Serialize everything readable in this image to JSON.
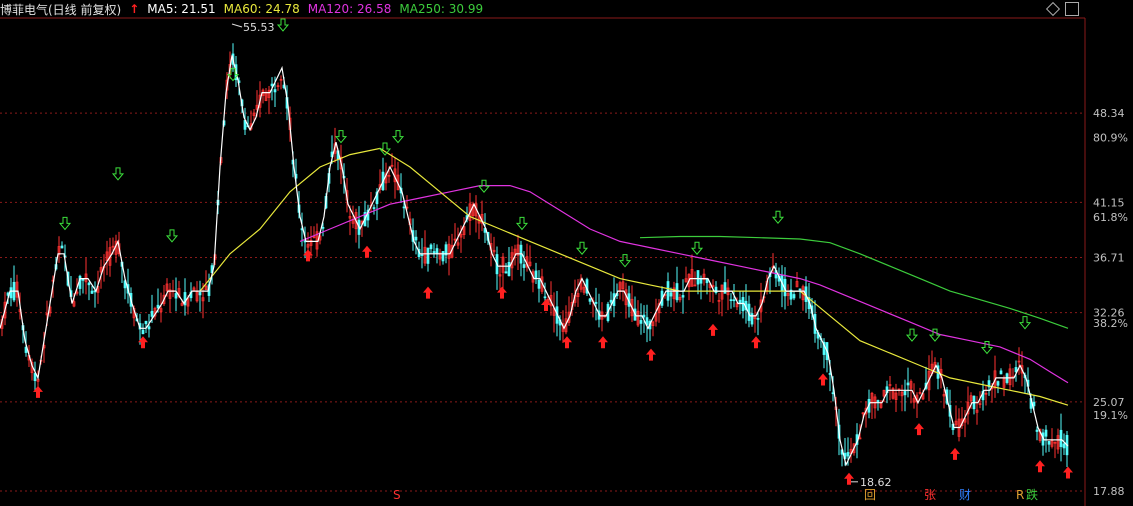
{
  "header": {
    "stock_title": "博菲电气(日线 前复权)",
    "ma5": "MA5: 21.51",
    "ma60": "MA60: 24.78",
    "ma120": "MA120: 26.58",
    "ma250": "MA250: 30.99"
  },
  "colors": {
    "background": "#000000",
    "up": "#ff3232",
    "down": "#54fcfc",
    "ma5": "#ffffff",
    "ma60": "#e8e83c",
    "ma120": "#e033e0",
    "ma250": "#3ccc3c",
    "grid": "#8a1a1a",
    "axis_text": "#c0c0c0",
    "buy_arrow": "#ff2020",
    "sell_arrow": "#3ce03c"
  },
  "price_axis": {
    "prices": [
      "48.34",
      "41.15",
      "36.71",
      "32.26",
      "25.07",
      "17.88"
    ],
    "percents": [
      "80.9%",
      "61.8%",
      "38.2%",
      "19.1%"
    ]
  },
  "annotations": {
    "high_label": "55.53",
    "low_label": "18.62"
  },
  "event_badges": [
    "S",
    "回",
    "张",
    "财",
    "R",
    "跌"
  ],
  "chart_data": {
    "type": "candlestick",
    "title": "博菲电气(日线 前复权)",
    "y_range": [
      17.88,
      55.53
    ],
    "high": 55.53,
    "low": 18.62,
    "ma_current": {
      "MA5": 21.51,
      "MA60": 24.78,
      "MA120": 26.58,
      "MA250": 30.99
    },
    "ma5_path": [
      [
        0,
        31
      ],
      [
        10,
        34
      ],
      [
        18,
        34
      ],
      [
        25,
        30
      ],
      [
        32,
        28
      ],
      [
        38,
        27
      ],
      [
        44,
        30
      ],
      [
        50,
        33
      ],
      [
        58,
        37
      ],
      [
        64,
        37
      ],
      [
        72,
        33
      ],
      [
        80,
        35
      ],
      [
        88,
        35
      ],
      [
        96,
        34
      ],
      [
        104,
        36
      ],
      [
        112,
        37
      ],
      [
        118,
        38
      ],
      [
        125,
        35
      ],
      [
        132,
        33
      ],
      [
        140,
        31
      ],
      [
        146,
        31
      ],
      [
        154,
        32
      ],
      [
        162,
        33
      ],
      [
        168,
        34
      ],
      [
        176,
        34
      ],
      [
        184,
        33
      ],
      [
        192,
        34
      ],
      [
        200,
        34
      ],
      [
        208,
        34
      ],
      [
        214,
        36
      ],
      [
        220,
        44
      ],
      [
        226,
        50
      ],
      [
        232,
        53
      ],
      [
        238,
        51
      ],
      [
        244,
        48
      ],
      [
        250,
        47
      ],
      [
        256,
        48
      ],
      [
        262,
        50
      ],
      [
        270,
        50
      ],
      [
        276,
        51
      ],
      [
        282,
        52
      ],
      [
        288,
        49
      ],
      [
        294,
        44
      ],
      [
        300,
        40
      ],
      [
        306,
        38
      ],
      [
        312,
        38
      ],
      [
        318,
        38
      ],
      [
        324,
        40
      ],
      [
        330,
        44
      ],
      [
        336,
        46
      ],
      [
        342,
        44
      ],
      [
        348,
        41
      ],
      [
        354,
        40
      ],
      [
        360,
        39
      ],
      [
        366,
        40
      ],
      [
        372,
        41
      ],
      [
        378,
        42
      ],
      [
        384,
        43
      ],
      [
        390,
        44
      ],
      [
        396,
        43
      ],
      [
        402,
        42
      ],
      [
        408,
        40
      ],
      [
        414,
        38
      ],
      [
        420,
        37
      ],
      [
        426,
        37
      ],
      [
        432,
        37
      ],
      [
        438,
        37
      ],
      [
        444,
        37
      ],
      [
        450,
        37
      ],
      [
        456,
        38
      ],
      [
        462,
        39
      ],
      [
        468,
        40
      ],
      [
        474,
        41
      ],
      [
        480,
        40
      ],
      [
        486,
        39
      ],
      [
        492,
        37
      ],
      [
        498,
        36
      ],
      [
        504,
        36
      ],
      [
        510,
        36
      ],
      [
        516,
        37
      ],
      [
        522,
        37
      ],
      [
        528,
        36
      ],
      [
        534,
        35
      ],
      [
        540,
        35
      ],
      [
        546,
        34
      ],
      [
        552,
        33
      ],
      [
        558,
        32
      ],
      [
        564,
        31
      ],
      [
        570,
        32
      ],
      [
        576,
        34
      ],
      [
        582,
        35
      ],
      [
        588,
        34
      ],
      [
        594,
        33
      ],
      [
        600,
        32
      ],
      [
        606,
        32
      ],
      [
        612,
        33
      ],
      [
        618,
        34
      ],
      [
        624,
        34
      ],
      [
        630,
        33
      ],
      [
        636,
        32
      ],
      [
        642,
        32
      ],
      [
        648,
        31
      ],
      [
        654,
        32
      ],
      [
        660,
        33
      ],
      [
        666,
        34
      ],
      [
        672,
        34
      ],
      [
        678,
        34
      ],
      [
        684,
        34
      ],
      [
        690,
        35
      ],
      [
        696,
        35
      ],
      [
        702,
        35
      ],
      [
        708,
        35
      ],
      [
        714,
        34
      ],
      [
        720,
        34
      ],
      [
        726,
        34
      ],
      [
        732,
        34
      ],
      [
        738,
        33
      ],
      [
        744,
        33
      ],
      [
        750,
        32
      ],
      [
        756,
        32
      ],
      [
        762,
        33
      ],
      [
        768,
        35
      ],
      [
        774,
        36
      ],
      [
        780,
        35
      ],
      [
        786,
        34
      ],
      [
        792,
        34
      ],
      [
        798,
        34
      ],
      [
        804,
        34
      ],
      [
        810,
        33
      ],
      [
        816,
        31
      ],
      [
        822,
        30
      ],
      [
        828,
        29
      ],
      [
        834,
        26
      ],
      [
        840,
        22
      ],
      [
        846,
        20
      ],
      [
        852,
        21
      ],
      [
        858,
        22
      ],
      [
        864,
        24
      ],
      [
        870,
        25
      ],
      [
        876,
        25
      ],
      [
        882,
        25
      ],
      [
        888,
        26
      ],
      [
        894,
        26
      ],
      [
        900,
        26
      ],
      [
        906,
        26
      ],
      [
        912,
        26
      ],
      [
        918,
        25
      ],
      [
        924,
        26
      ],
      [
        930,
        27
      ],
      [
        936,
        28
      ],
      [
        942,
        27
      ],
      [
        948,
        25
      ],
      [
        954,
        23
      ],
      [
        960,
        23
      ],
      [
        966,
        24
      ],
      [
        972,
        25
      ],
      [
        978,
        25
      ],
      [
        984,
        26
      ],
      [
        990,
        26
      ],
      [
        996,
        27
      ],
      [
        1002,
        27
      ],
      [
        1008,
        27
      ],
      [
        1014,
        27
      ],
      [
        1020,
        28
      ],
      [
        1026,
        27
      ],
      [
        1032,
        25
      ],
      [
        1038,
        23
      ],
      [
        1044,
        22
      ],
      [
        1050,
        22
      ],
      [
        1056,
        22
      ],
      [
        1062,
        22
      ],
      [
        1068,
        21.5
      ]
    ],
    "ma60_path": [
      [
        200,
        34
      ],
      [
        230,
        37
      ],
      [
        260,
        39
      ],
      [
        290,
        42
      ],
      [
        320,
        44
      ],
      [
        350,
        45
      ],
      [
        380,
        45.5
      ],
      [
        410,
        44
      ],
      [
        440,
        42
      ],
      [
        470,
        40
      ],
      [
        500,
        39
      ],
      [
        530,
        38
      ],
      [
        560,
        37
      ],
      [
        590,
        36
      ],
      [
        620,
        35
      ],
      [
        650,
        34.5
      ],
      [
        680,
        34
      ],
      [
        710,
        34
      ],
      [
        740,
        34
      ],
      [
        770,
        34
      ],
      [
        800,
        34
      ],
      [
        830,
        32
      ],
      [
        860,
        30
      ],
      [
        890,
        29
      ],
      [
        920,
        28
      ],
      [
        950,
        27
      ],
      [
        980,
        26.5
      ],
      [
        1010,
        26
      ],
      [
        1040,
        25.5
      ],
      [
        1068,
        24.8
      ]
    ],
    "ma120_path": [
      [
        300,
        38
      ],
      [
        330,
        39
      ],
      [
        360,
        40
      ],
      [
        390,
        41
      ],
      [
        420,
        41.5
      ],
      [
        450,
        42
      ],
      [
        480,
        42.5
      ],
      [
        510,
        42.5
      ],
      [
        530,
        42
      ],
      [
        560,
        40.5
      ],
      [
        590,
        39
      ],
      [
        620,
        38
      ],
      [
        650,
        37.5
      ],
      [
        680,
        37
      ],
      [
        710,
        36.5
      ],
      [
        740,
        36
      ],
      [
        770,
        35.5
      ],
      [
        800,
        35
      ],
      [
        820,
        34.5
      ],
      [
        850,
        33.5
      ],
      [
        880,
        32.5
      ],
      [
        910,
        31.5
      ],
      [
        940,
        30.5
      ],
      [
        970,
        30
      ],
      [
        1000,
        29.5
      ],
      [
        1030,
        28.5
      ],
      [
        1050,
        27.5
      ],
      [
        1068,
        26.6
      ]
    ],
    "ma250_path": [
      [
        640,
        38.3
      ],
      [
        680,
        38.4
      ],
      [
        720,
        38.4
      ],
      [
        760,
        38.3
      ],
      [
        800,
        38.2
      ],
      [
        830,
        37.9
      ],
      [
        860,
        37
      ],
      [
        890,
        36
      ],
      [
        920,
        35
      ],
      [
        950,
        34
      ],
      [
        980,
        33.3
      ],
      [
        1010,
        32.6
      ],
      [
        1040,
        31.8
      ],
      [
        1068,
        31
      ]
    ],
    "buy_signals": [
      [
        38,
        27
      ],
      [
        143,
        31
      ],
      [
        308,
        38
      ],
      [
        367,
        38.3
      ],
      [
        428,
        35
      ],
      [
        502,
        35
      ],
      [
        546,
        34
      ],
      [
        567,
        31
      ],
      [
        603,
        31
      ],
      [
        651,
        30
      ],
      [
        713,
        32
      ],
      [
        756,
        31
      ],
      [
        823,
        28
      ],
      [
        849,
        20
      ],
      [
        919,
        24
      ],
      [
        955,
        22
      ],
      [
        1040,
        21
      ],
      [
        1068,
        20.5
      ]
    ],
    "sell_signals": [
      [
        65,
        38
      ],
      [
        118,
        42
      ],
      [
        172,
        37
      ],
      [
        233,
        50
      ],
      [
        283,
        54
      ],
      [
        341,
        45
      ],
      [
        385,
        44
      ],
      [
        398,
        45
      ],
      [
        484,
        41
      ],
      [
        522,
        38
      ],
      [
        582,
        36
      ],
      [
        625,
        35
      ],
      [
        697,
        36
      ],
      [
        778,
        38.5
      ],
      [
        912,
        29
      ],
      [
        935,
        29
      ],
      [
        987,
        28
      ],
      [
        1025,
        30
      ]
    ]
  }
}
